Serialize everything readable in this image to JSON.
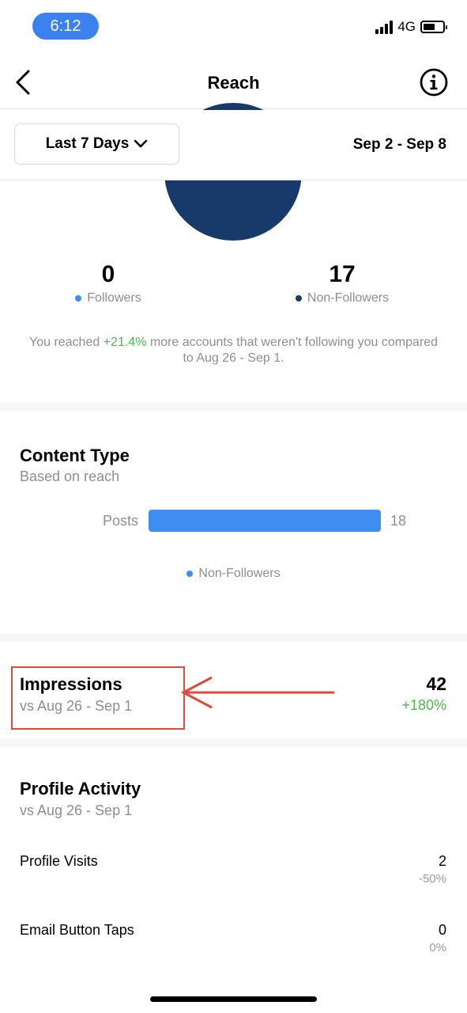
{
  "status_bar": {
    "time": "6:12",
    "network": "4G",
    "battery_level": 0.6
  },
  "nav": {
    "title": "Reach"
  },
  "filter": {
    "period_label": "Last 7 Days",
    "date_range": "Sep 2 - Sep 8"
  },
  "audience": {
    "followers": {
      "value": "0",
      "label": "Followers",
      "color": "#3d8ef0"
    },
    "non_followers": {
      "value": "17",
      "label": "Non-Followers",
      "color": "#173a6a"
    },
    "summary_prefix": "You reached ",
    "summary_change": "+21.4%",
    "summary_suffix": " more accounts that weren't following you compared to Aug 26 - Sep 1."
  },
  "content_type": {
    "title": "Content Type",
    "subtitle": "Based on reach",
    "bars": [
      {
        "label": "Posts",
        "value": 18
      }
    ],
    "legend": "Non-Followers"
  },
  "impressions": {
    "title": "Impressions",
    "subtitle": "vs Aug 26 - Sep 1",
    "value": "42",
    "change": "+180%"
  },
  "profile_activity": {
    "title": "Profile Activity",
    "subtitle": "vs Aug 26 - Sep 1",
    "rows": [
      {
        "label": "Profile Visits",
        "value": "2",
        "change": "-50%"
      },
      {
        "label": "Email Button Taps",
        "value": "0",
        "change": "0%"
      }
    ]
  },
  "colors": {
    "accent_blue": "#3d8ef0",
    "dark_blue": "#173a6a",
    "positive_green": "#4cb84a",
    "annotation_red": "#e0483c"
  }
}
